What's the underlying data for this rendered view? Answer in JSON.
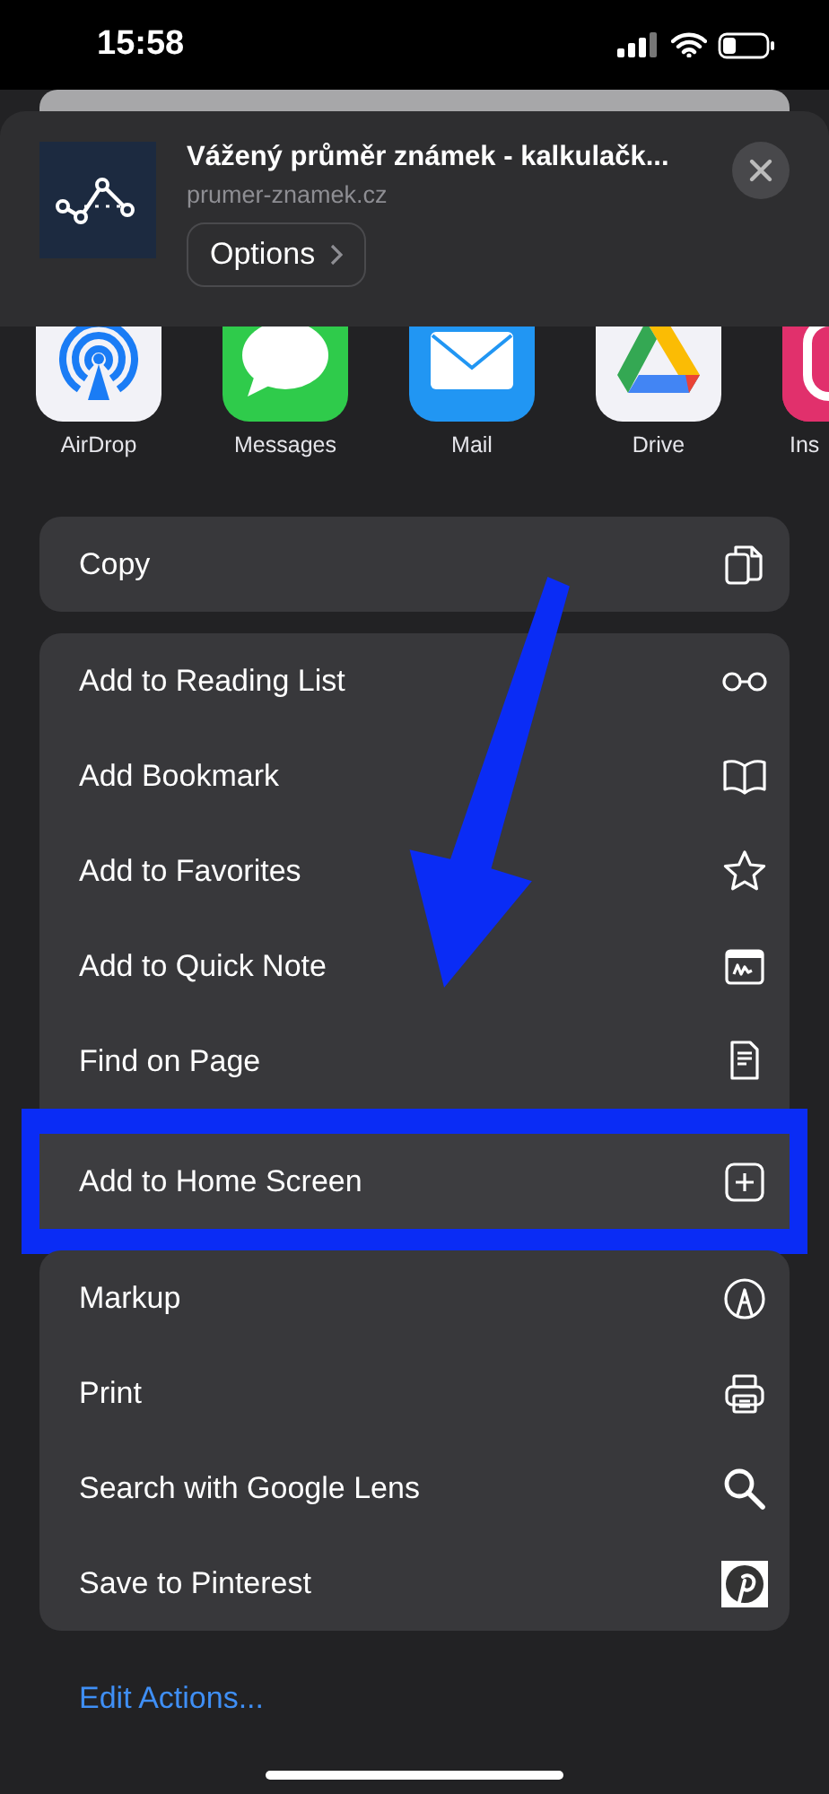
{
  "status_bar": {
    "time": "15:58"
  },
  "share_header": {
    "title": "Vážený průměr známek - kalkulačk...",
    "url": "prumer-znamek.cz",
    "options_button": "Options"
  },
  "apps": [
    {
      "name": "AirDrop",
      "kind": "airdrop"
    },
    {
      "name": "Messages",
      "kind": "messages"
    },
    {
      "name": "Mail",
      "kind": "mail"
    },
    {
      "name": "Drive",
      "kind": "drive"
    },
    {
      "name": "Ins",
      "kind": "instagram"
    }
  ],
  "action_groups": [
    [
      {
        "label": "Copy",
        "kind": "copy",
        "highlighted": false
      }
    ],
    [
      {
        "label": "Add to Reading List",
        "kind": "glasses",
        "highlighted": false
      },
      {
        "label": "Add Bookmark",
        "kind": "book",
        "highlighted": false
      },
      {
        "label": "Add to Favorites",
        "kind": "star",
        "highlighted": false
      },
      {
        "label": "Add to Quick Note",
        "kind": "note",
        "highlighted": false
      },
      {
        "label": "Find on Page",
        "kind": "page",
        "highlighted": false
      },
      {
        "label": "Add to Home Screen",
        "kind": "plus",
        "highlighted": true
      }
    ],
    [
      {
        "label": "Markup",
        "kind": "markup",
        "highlighted": false
      },
      {
        "label": "Print",
        "kind": "printer",
        "highlighted": false
      },
      {
        "label": "Search with Google Lens",
        "kind": "search",
        "highlighted": false
      },
      {
        "label": "Save to Pinterest",
        "kind": "pinterest",
        "highlighted": false
      }
    ]
  ],
  "edit_actions_link": "Edit Actions..."
}
